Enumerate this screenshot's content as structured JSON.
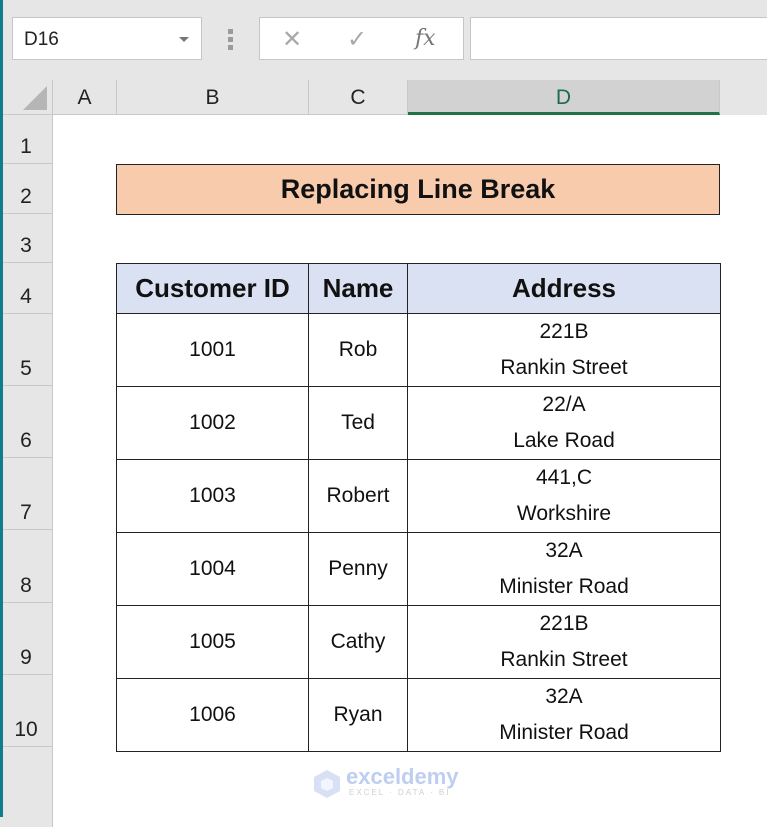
{
  "formula_bar": {
    "name_box": "D16",
    "formula": "",
    "cancel_icon": "✕",
    "enter_icon": "✓",
    "fx_label": "fx"
  },
  "columns": [
    {
      "label": "A",
      "selected": false
    },
    {
      "label": "B",
      "selected": false
    },
    {
      "label": "C",
      "selected": false
    },
    {
      "label": "D",
      "selected": true
    }
  ],
  "rows": [
    "1",
    "2",
    "3",
    "4",
    "5",
    "6",
    "7",
    "8",
    "9",
    "10"
  ],
  "title": "Replacing Line Break",
  "table": {
    "headers": [
      "Customer ID",
      "Name",
      "Address"
    ],
    "rows": [
      {
        "id": "1001",
        "name": "Rob",
        "address": [
          "221B",
          "Rankin Street"
        ]
      },
      {
        "id": "1002",
        "name": "Ted",
        "address": [
          "22/A",
          "Lake Road"
        ]
      },
      {
        "id": "1003",
        "name": "Robert",
        "address": [
          "441,C",
          "Workshire"
        ]
      },
      {
        "id": "1004",
        "name": "Penny",
        "address": [
          "32A",
          "Minister Road"
        ]
      },
      {
        "id": "1005",
        "name": "Cathy",
        "address": [
          "221B",
          "Rankin Street"
        ]
      },
      {
        "id": "1006",
        "name": "Ryan",
        "address": [
          "32A",
          "Minister Road"
        ]
      }
    ]
  },
  "watermark": {
    "brand": "exceldemy",
    "tagline": "EXCEL · DATA · BI"
  },
  "colors": {
    "title_fill": "#f8cbad",
    "header_fill": "#d9e1f2",
    "selection_accent": "#217346"
  }
}
